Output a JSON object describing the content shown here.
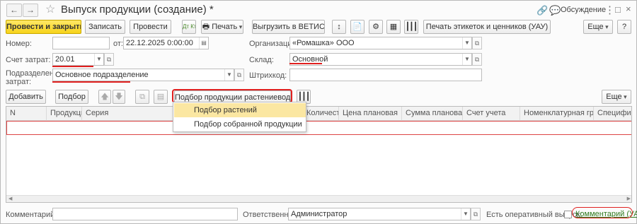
{
  "window": {
    "title": "Выпуск продукции (создание) *",
    "discussion": "Обсуждение",
    "menu_icon": "more-vert-icon"
  },
  "toolbar": {
    "post_close": "Провести и закрыть",
    "save": "Записать",
    "post": "Провести",
    "print": "Печать",
    "vetis": "Выгрузить в ВЕТИС",
    "labels": "Печать этикеток и ценников (УАУ)",
    "more": "Еще",
    "help": "?"
  },
  "form": {
    "number_label": "Номер:",
    "number_value": "",
    "from_label": "от:",
    "date_value": "22.12.2025  0:00:00",
    "org_label": "Организация:",
    "org_value": "«Ромашка» ООО",
    "account_label": "Счет затрат:",
    "account_value": "20.01",
    "warehouse_label": "Склад:",
    "warehouse_value": "Основной",
    "division_label": "Подразделение затрат:",
    "division_value": "Основное подразделение",
    "barcode_label": "Штрихкод:",
    "barcode_value": ""
  },
  "table_toolbar": {
    "add": "Добавить",
    "pick": "Подбор",
    "plant_pick": "Подбор продукции растениеводства",
    "more": "Еще"
  },
  "table": {
    "columns": [
      "N",
      "Продукция",
      "Серия",
      "Количество",
      "Цена плановая",
      "Сумма плановая",
      "Счет учета",
      "Номенклатурная группа",
      "Спецификация"
    ]
  },
  "popup": {
    "items": [
      "Подбор растений",
      "Подбор собранной продукции"
    ]
  },
  "footer": {
    "comment_label": "Комментарий:",
    "comment_value": "",
    "responsible_label": "Ответственный:",
    "responsible_value": "Администратор",
    "operative_label": "Есть оперативный выпуск:",
    "comment_link": "Комментарий (УАУ)"
  }
}
